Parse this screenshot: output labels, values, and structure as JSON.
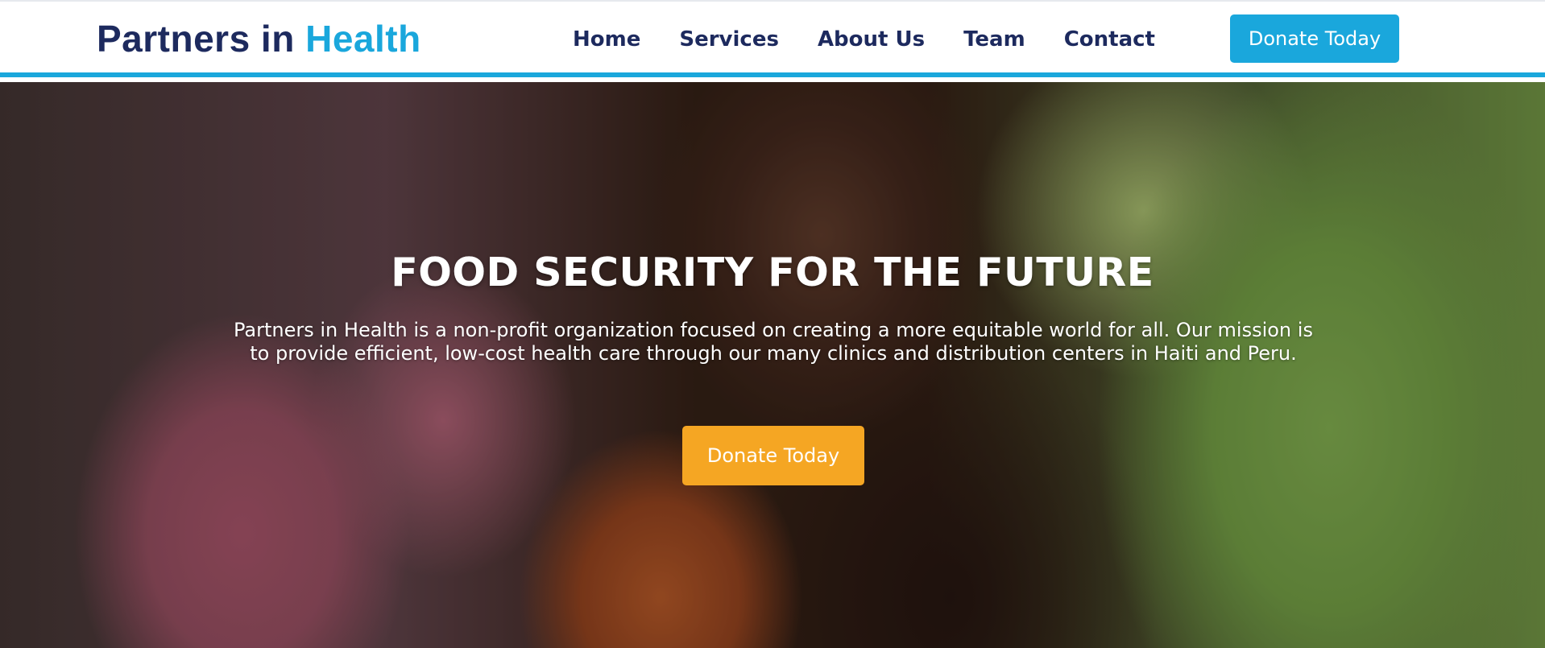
{
  "header": {
    "logo": {
      "part1": "Partners in",
      "part2": "Health"
    },
    "nav": [
      "Home",
      "Services",
      "About Us",
      "Team",
      "Contact"
    ],
    "donate_label": "Donate Today"
  },
  "hero": {
    "title": "FOOD SECURITY FOR THE FUTURE",
    "description": "Partners in Health is a non-profit organization focused on creating a more equitable world for all. Our mission is to provide efficient, low-cost health care through our many clinics and distribution centers in Haiti and Peru.",
    "donate_label": "Donate Today",
    "background_image": "photo of a child held on an adult's shoulder"
  },
  "colors": {
    "navy": "#1d2a5e",
    "accent_blue": "#1aa7dc",
    "accent_orange": "#f5a623",
    "white": "#ffffff"
  }
}
